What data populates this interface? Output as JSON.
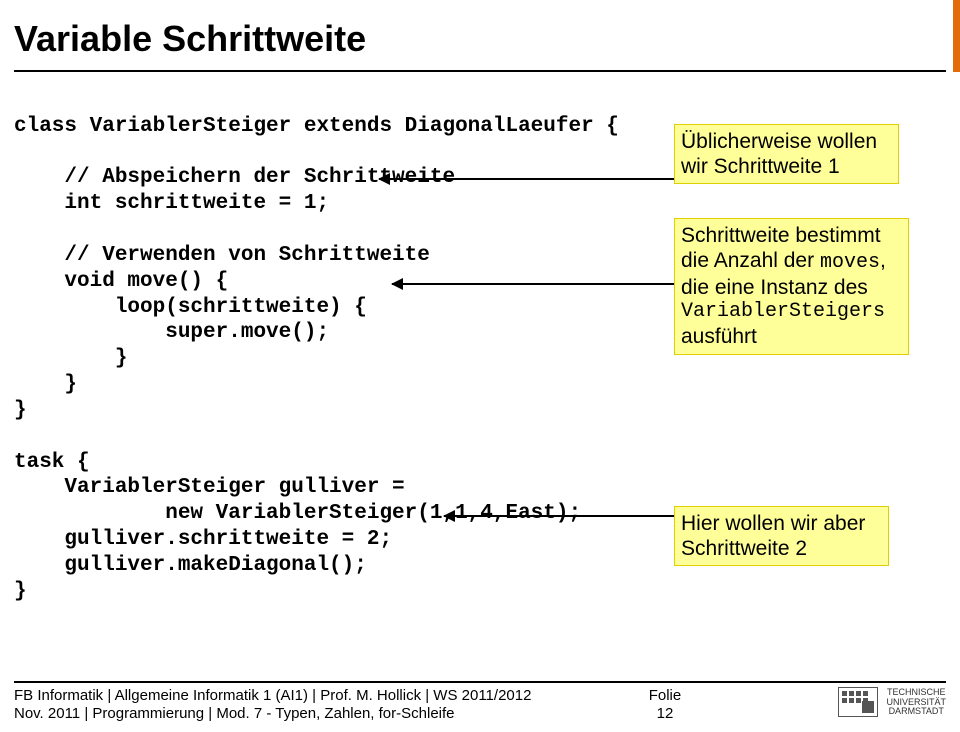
{
  "title": "Variable Schrittweite",
  "code": {
    "l01": "class VariablerSteiger extends DiagonalLaeufer {",
    "l02": "",
    "l03": "    // Abspeichern der Schrittweite",
    "l04": "    int schrittweite = 1;",
    "l05": "",
    "l06": "    // Verwenden von Schrittweite",
    "l07": "    void move() {",
    "l08": "        loop(schrittweite) {",
    "l09": "            super.move();",
    "l10": "        }",
    "l11": "    }",
    "l12": "}",
    "l13": "",
    "l14": "task {",
    "l15": "    VariablerSteiger gulliver = ",
    "l16": "            new VariablerSteiger(1,1,4,East);",
    "l17": "    gulliver.schrittweite = 2;",
    "l18": "    gulliver.makeDiagonal();",
    "l19": "}"
  },
  "notes": {
    "n1_a": "Üblicherweise wollen",
    "n1_b": "wir Schrittweite 1",
    "n2_a": "Schrittweite bestimmt",
    "n2_b": "die Anzahl der ",
    "n2_b_mono": "moves",
    "n2_b_after": ",",
    "n2_c": "die eine Instanz des",
    "n2_d_mono": "VariablerSteigers",
    "n2_e": "ausführt",
    "n3_a": "Hier wollen wir aber",
    "n3_b": "Schrittweite 2"
  },
  "footer": {
    "left1": "FB Informatik | Allgemeine Informatik 1 (AI1) | Prof. M. Hollick | WS 2011/2012",
    "left2": "Nov. 2011 | Programmierung | Mod. 7 - Typen, Zahlen, for-Schleife",
    "center1": "Folie",
    "center2": "12",
    "uni1": "TECHNISCHE",
    "uni2": "UNIVERSITÄT",
    "uni3": "DARMSTADT"
  }
}
